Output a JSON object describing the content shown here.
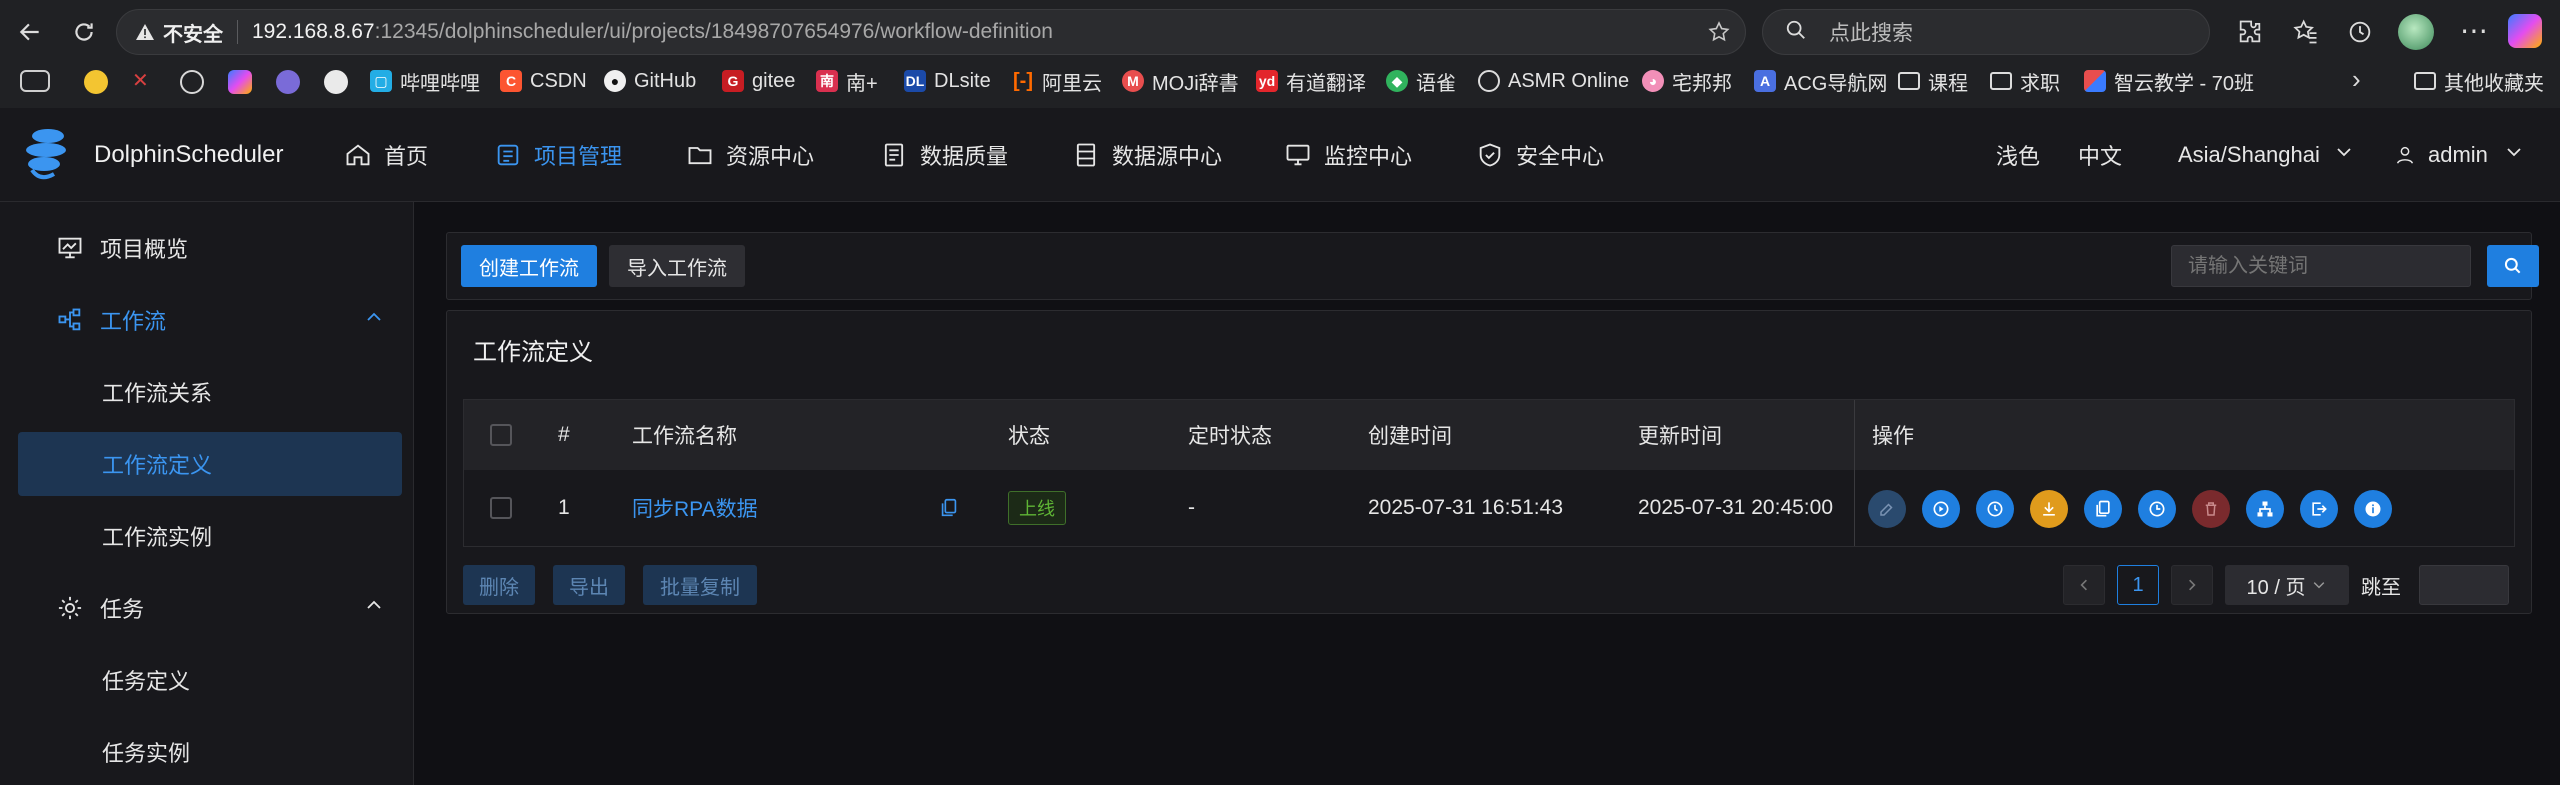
{
  "browser": {
    "security_label": "不安全",
    "url_host": "192.168.8.67",
    "url_rest": ":12345/dolphinscheduler/ui/projects/18498707654976/workflow-definition",
    "search_placeholder": "点此搜索",
    "bookmarks": [
      "哔哩哔哩",
      "CSDN",
      "GitHub",
      "gitee",
      "南+",
      "DLsite",
      "阿里云",
      "MOJi辞書",
      "有道翻译",
      "语雀",
      "ASMR Online",
      "宅邦邦",
      "ACG导航网",
      "课程",
      "求职",
      "智云教学 - 70班"
    ],
    "other_bookmarks": "其他收藏夹"
  },
  "app": {
    "logo_text": "DolphinScheduler",
    "nav": [
      "首页",
      "项目管理",
      "资源中心",
      "数据质量",
      "数据源中心",
      "监控中心",
      "安全中心"
    ],
    "theme": "浅色",
    "language": "中文",
    "timezone": "Asia/Shanghai",
    "user": "admin"
  },
  "sidebar": {
    "items": [
      {
        "label": "项目概览"
      },
      {
        "label": "工作流"
      },
      {
        "label": "工作流关系"
      },
      {
        "label": "工作流定义"
      },
      {
        "label": "工作流实例"
      },
      {
        "label": "任务"
      },
      {
        "label": "任务定义"
      },
      {
        "label": "任务实例"
      }
    ]
  },
  "toolbar": {
    "create_label": "创建工作流",
    "import_label": "导入工作流",
    "search_placeholder": "请输入关键词"
  },
  "table": {
    "title": "工作流定义",
    "headers": [
      "#",
      "工作流名称",
      "状态",
      "定时状态",
      "创建时间",
      "更新时间",
      "操作"
    ],
    "rows": [
      {
        "index": "1",
        "name": "同步RPA数据",
        "status": "上线",
        "schedule": "-",
        "created": "2025-07-31 16:51:43",
        "updated": "2025-07-31 20:45:00"
      }
    ]
  },
  "footer": {
    "delete_label": "删除",
    "export_label": "导出",
    "batch_copy_label": "批量复制",
    "current_page": "1",
    "page_size": "10 / 页",
    "jump_label": "跳至"
  },
  "colors": {
    "accent": "#1f7fe0",
    "link": "#3b95f0",
    "online_green": "#5fb535",
    "orange": "#e09b1c",
    "danger": "#7a2a2d"
  }
}
